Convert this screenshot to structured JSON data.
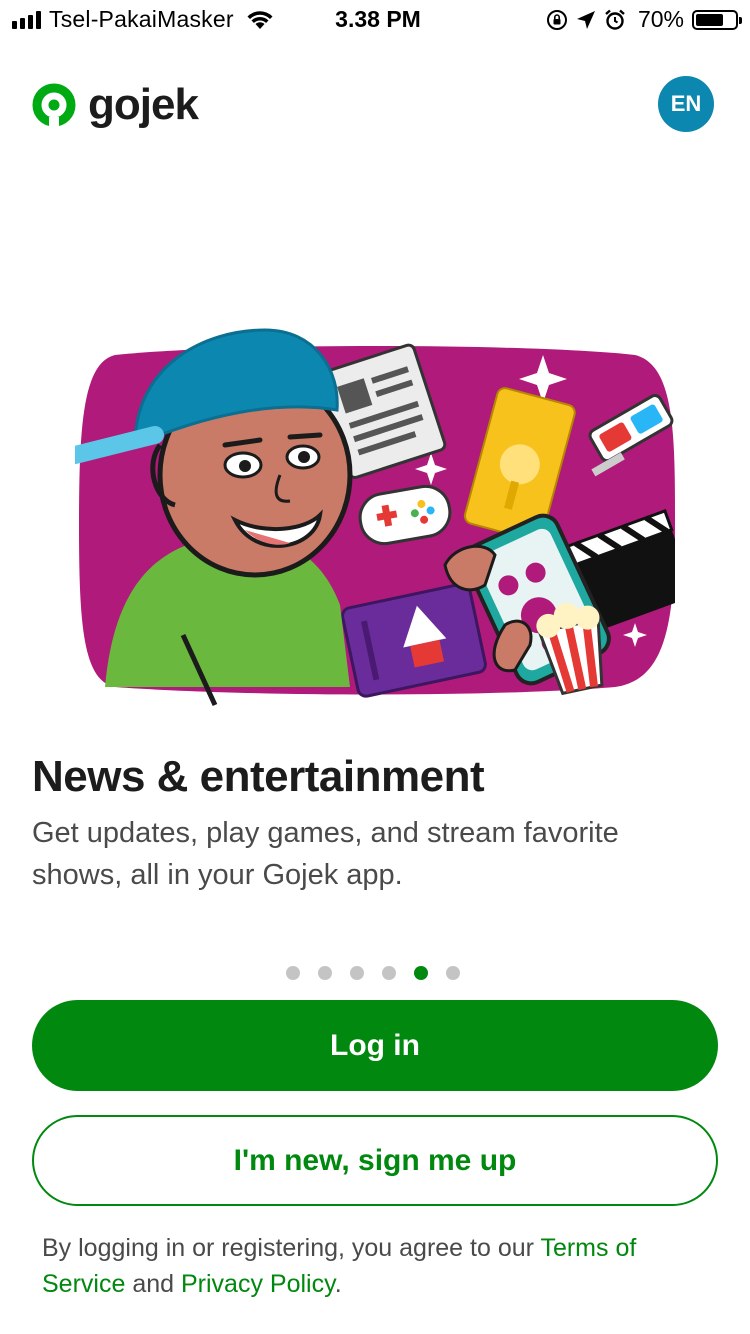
{
  "status_bar": {
    "carrier": "Tsel-PakaiMasker",
    "time": "3.38 PM",
    "battery": "70%",
    "battery_level": 0.7,
    "icons": [
      "signal-icon",
      "wifi-icon",
      "rotation-lock-icon",
      "location-icon",
      "alarm-icon",
      "battery-icon"
    ]
  },
  "header": {
    "logo_text": "gojek",
    "language_button": "EN"
  },
  "onboarding": {
    "title": "News & entertainment",
    "description": "Get updates, play games, and stream favorite shows, all in your Gojek app.",
    "page_count": 6,
    "active_page": 5
  },
  "actions": {
    "login_label": "Log in",
    "signup_label": "I'm new, sign me up"
  },
  "legal": {
    "prefix": "By logging in or registering, you agree to our ",
    "terms_link": "Terms of Service",
    "conjunction": " and ",
    "privacy_link": "Privacy Policy",
    "suffix": "."
  },
  "colors": {
    "brand_green": "#00880f",
    "language_badge": "#0c88b0",
    "illustration_bg": "#b01a7a",
    "dot_inactive": "#c4c4c4"
  }
}
